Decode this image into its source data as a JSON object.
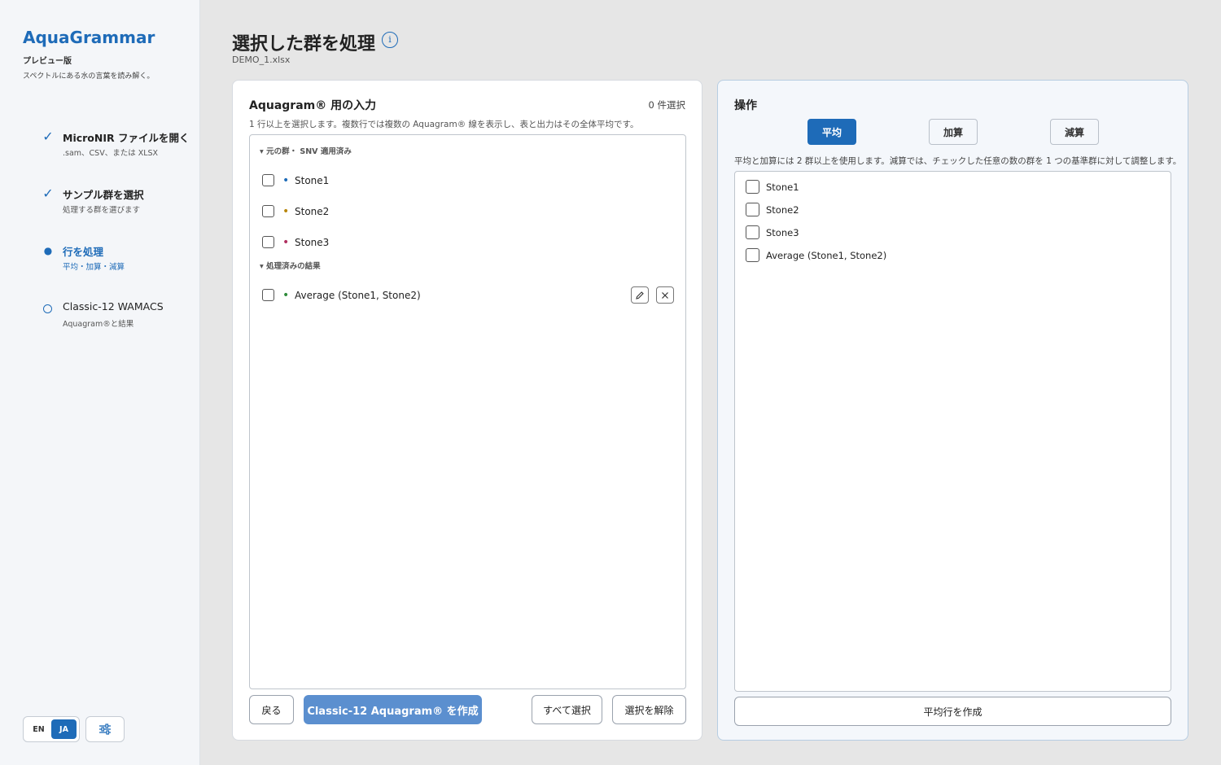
{
  "app": {
    "name": "AquaGrammar",
    "edition": "プレビュー版",
    "tagline": "スペクトルにある水の言葉を読み解く。"
  },
  "steps": [
    {
      "title": "MicroNIR ファイルを開く",
      "sub": ".sam、CSV、または XLSX",
      "state": "done"
    },
    {
      "title": "サンプル群を選択",
      "sub": "処理する群を選びます",
      "state": "done"
    },
    {
      "title": "行を処理",
      "sub": "平均・加算・減算",
      "state": "active"
    },
    {
      "title": "Classic-12 WAMACS",
      "sub": "Aquagram®と結果",
      "state": "pending"
    }
  ],
  "lang": {
    "en": "EN",
    "ja": "JA",
    "selected": "JA"
  },
  "header": {
    "title": "選択した群を処理",
    "info_icon": "i",
    "file": "DEMO_1.xlsx"
  },
  "input_panel": {
    "title": "Aquagram® 用の入力",
    "count": "0 件選択",
    "description": "1 行以上を選択します。複数行では複数の Aquagram® 線を表示し、表と出力はその全体平均です。",
    "group_original": "▾ 元の群・ SNV 適用済み",
    "group_processed": "▾ 処理済みの結果",
    "original_rows": [
      {
        "label": "Stone1",
        "color": "#1e6bb8"
      },
      {
        "label": "Stone2",
        "color": "#b8860b"
      },
      {
        "label": "Stone3",
        "color": "#b03060"
      }
    ],
    "processed_rows": [
      {
        "label": "Average (Stone1, Stone2)",
        "color": "#2e8b3a"
      }
    ],
    "buttons": {
      "back": "戻る",
      "create": "Classic-12 Aquagram® を作成",
      "select_all": "すべて選択",
      "clear": "選択を解除"
    }
  },
  "operations_panel": {
    "title": "操作",
    "modes": [
      "平均",
      "加算",
      "減算"
    ],
    "selected_mode": "平均",
    "description": "平均と加算には 2 群以上を使用します。減算では、チェックした任意の数の群を 1 つの基準群に対して調整します。",
    "rows": [
      "Stone1",
      "Stone2",
      "Stone3",
      "Average (Stone1, Stone2)"
    ],
    "action": "平均行を作成"
  }
}
